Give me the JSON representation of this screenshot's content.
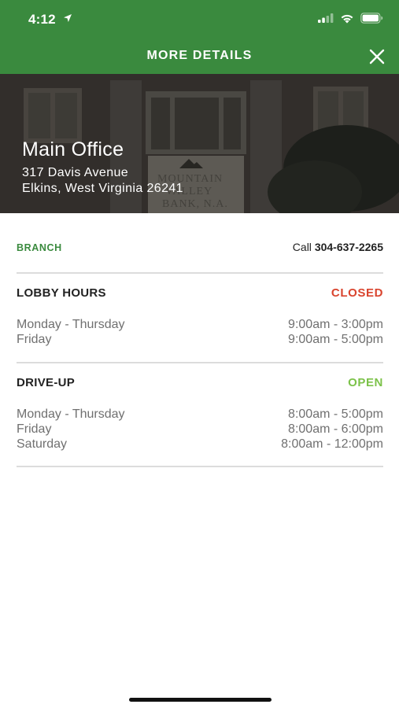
{
  "status_bar": {
    "time": "4:12"
  },
  "header": {
    "title": "MORE DETAILS"
  },
  "location": {
    "name": "Main Office",
    "address_line1": "317 Davis Avenue",
    "address_line2": "Elkins, West Virginia 26241",
    "sign_text_1": "MOUNTAIN",
    "sign_text_2": "VALLEY",
    "sign_text_3": "BANK, N.A."
  },
  "branch": {
    "label": "BRANCH",
    "call_prefix": "Call",
    "phone": "304-637-2265"
  },
  "lobby": {
    "title": "LOBBY HOURS",
    "status": "CLOSED",
    "status_color": "#d9442e",
    "hours": [
      {
        "day": "Monday - Thursday",
        "time": "9:00am - 3:00pm"
      },
      {
        "day": "Friday",
        "time": "9:00am - 5:00pm"
      }
    ]
  },
  "driveup": {
    "title": "DRIVE-UP",
    "status": "OPEN",
    "status_color": "#7cc24a",
    "hours": [
      {
        "day": "Monday - Thursday",
        "time": "8:00am - 5:00pm"
      },
      {
        "day": "Friday",
        "time": "8:00am - 6:00pm"
      },
      {
        "day": "Saturday",
        "time": "8:00am - 12:00pm"
      }
    ]
  },
  "colors": {
    "brand_green": "#3a8a3e",
    "divider": "#dcdcdc"
  }
}
